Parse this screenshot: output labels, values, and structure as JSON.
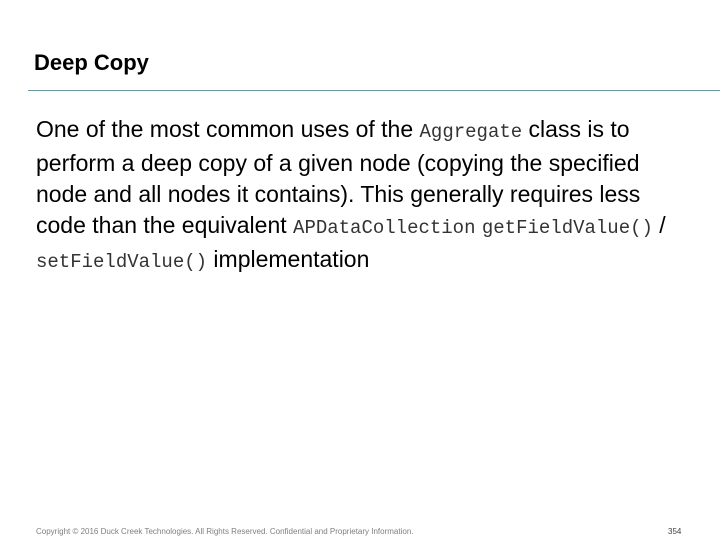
{
  "slide": {
    "title": "Deep Copy",
    "body": {
      "t1": "One of the most common uses of the ",
      "c1": "Aggregate",
      "t2": " class is to perform a deep copy of a given node (copying the specified node and all nodes it contains). This generally requires less code than the equivalent ",
      "c2": "APDataCollection",
      "t3": " ",
      "c3": "getFieldValue()",
      "t4": " / ",
      "c4": "setFieldValue()",
      "t5": " implementation"
    },
    "footer": "Copyright © 2016 Duck Creek Technologies. All Rights Reserved. Confidential and Proprietary Information.",
    "page_number": "354"
  },
  "colors": {
    "rule": "#4aa3b3",
    "footer_text": "#7f7f7f"
  }
}
